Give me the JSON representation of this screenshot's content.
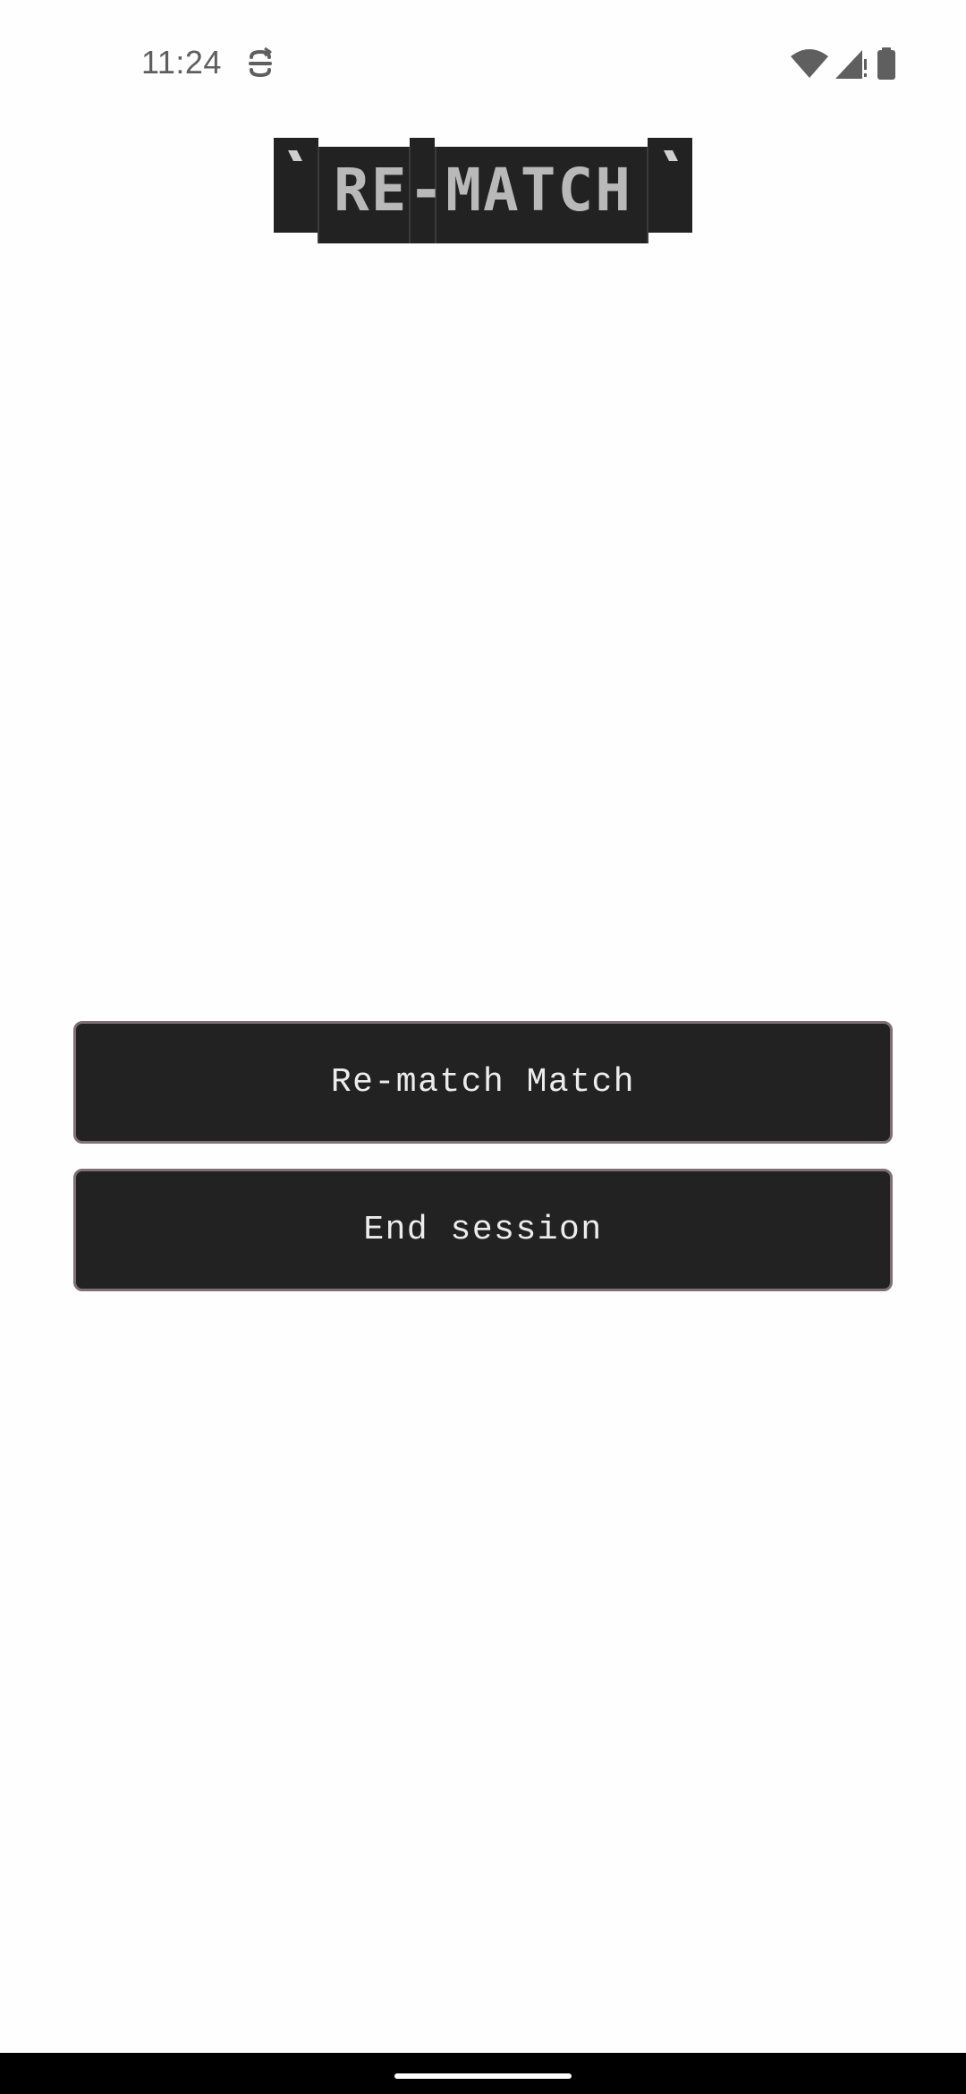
{
  "status_bar": {
    "time": "11:24",
    "left_icons": [
      "sync-icon"
    ],
    "right_icons": [
      "wifi-icon",
      "cellular-signal-icon",
      "battery-icon"
    ]
  },
  "logo": {
    "text": "RE-MATCH"
  },
  "actions": {
    "rematch_label": "Re-match Match",
    "end_session_label": "End session"
  },
  "nav_bar": {
    "handle": "home-handle"
  },
  "colors": {
    "background": "#fefefe",
    "button_fill": "#222222",
    "button_border": "#7f6f76",
    "button_text": "#ececec",
    "logo_fill": "#222222",
    "logo_text": "#b9b9b9",
    "status_icon": "#5f5f5f"
  }
}
